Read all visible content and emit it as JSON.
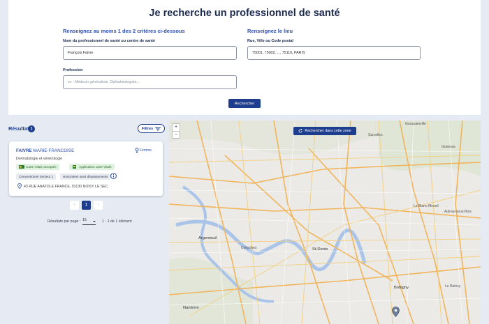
{
  "search": {
    "title": "Je recherche un professionnel de santé",
    "criteria_title": "Renseignez au moins 1 des 2 critères ci-dessous",
    "name_label": "Nom du professionnel de santé ou centre de santé",
    "name_value": "François Faivre",
    "profession_label": "Profession",
    "profession_placeholder": "ex : Médecin généraliste, Ophtalmologiste...",
    "location_title": "Renseignez le lieu",
    "location_label": "Rue, Ville ou Code postal",
    "location_value": "75001, 75002, ..., 75110, PARIS",
    "submit_label": "Rechercher"
  },
  "results": {
    "title": "Résultat",
    "count": "1",
    "filters_label": "Filtres",
    "items": [
      {
        "last_name": "FAIVRE",
        "first_name": "MARIE-FRANCOISE",
        "gender": "Femme",
        "specialty": "Dermatologie et vénérologie",
        "tags": [
          "Carte Vitale acceptée",
          "Application carte Vitale",
          "Conventionné Secteur 1",
          "Honoraires sans dépassements"
        ],
        "address": "43 RUE ANATOLE FRANCE, 93130 NOISY LE SEC"
      }
    ],
    "pagination": {
      "prev": "‹",
      "current": "1",
      "next": "›"
    },
    "per_page_label": "Résultats par page :",
    "per_page_value": "15",
    "range_label": "1 - 1 de 1 élément"
  },
  "map": {
    "zoom_in": "+",
    "zoom_out": "−",
    "search_area_label": "Rechercher dans cette zone",
    "labels": [
      "Goussainville",
      "Sarcelles",
      "Le Blanc-Mesnil",
      "Aulnay-sous-Bois",
      "Argenteuil",
      "Colombes",
      "St-Denis",
      "Bobigny",
      "Nanterre",
      "Le Raincy",
      "Gonesse"
    ]
  }
}
